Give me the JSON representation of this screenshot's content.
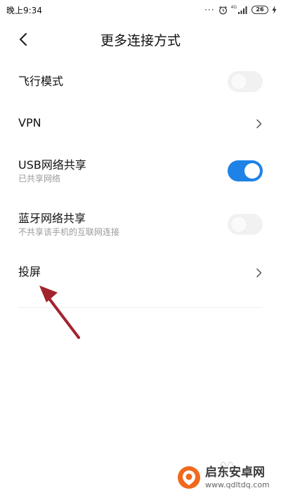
{
  "status_bar": {
    "time": "晚上9:34",
    "dots": "···",
    "network_label": "4G",
    "battery": "26",
    "icons": [
      "alarm-icon",
      "signal-icon",
      "battery-icon",
      "charging-icon"
    ]
  },
  "header": {
    "back_icon": "back-arrow-icon",
    "title": "更多连接方式"
  },
  "settings": {
    "airplane": {
      "label": "飞行模式",
      "enabled": false
    },
    "vpn": {
      "label": "VPN"
    },
    "usb_tethering": {
      "label": "USB网络共享",
      "subtitle": "已共享网络",
      "enabled": true
    },
    "bluetooth_tethering": {
      "label": "蓝牙网络共享",
      "subtitle": "不共享该手机的互联网连接",
      "enabled": false
    },
    "cast": {
      "label": "投屏"
    }
  },
  "watermark": {
    "title": "启东安卓网",
    "url": "www.qdltdq.com"
  },
  "colors": {
    "accent": "#1e82e6",
    "toggle_off": "#f1f1f1",
    "annotation_arrow": "#a3232d",
    "watermark_logo": "#f06a1d"
  }
}
